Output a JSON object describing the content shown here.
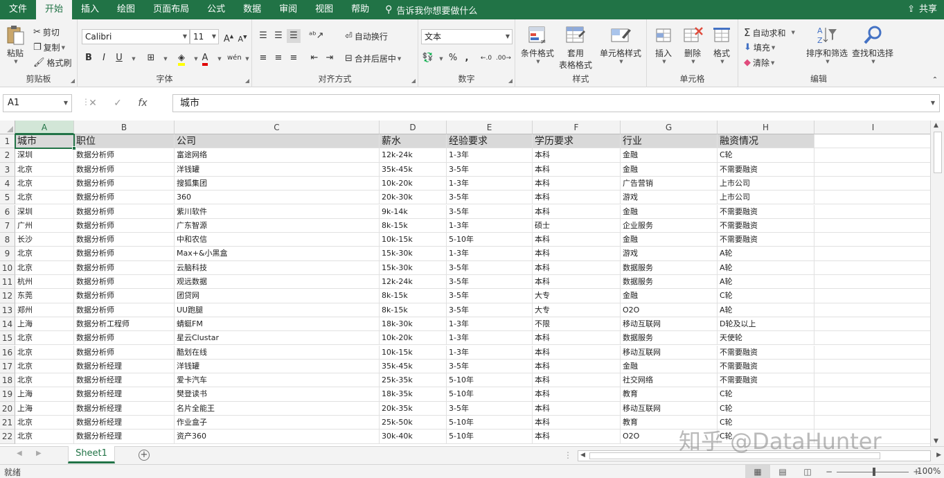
{
  "menu": {
    "tabs": [
      "文件",
      "开始",
      "插入",
      "绘图",
      "页面布局",
      "公式",
      "数据",
      "审阅",
      "视图",
      "帮助"
    ],
    "active_tab": "开始",
    "tell_me": "告诉我你想要做什么",
    "share": "共享"
  },
  "ribbon": {
    "clipboard": {
      "label": "剪贴板",
      "paste": "粘贴",
      "cut": "剪切",
      "copy": "复制",
      "format_painter": "格式刷"
    },
    "font": {
      "label": "字体",
      "font_name": "Calibri",
      "font_size": "11",
      "bold": "B",
      "italic": "I",
      "underline": "U"
    },
    "alignment": {
      "label": "对齐方式",
      "wrap_text": "自动换行",
      "merge_center": "合并后居中"
    },
    "number": {
      "label": "数字",
      "format": "文本",
      "percent": "%",
      "comma": ","
    },
    "styles": {
      "label": "样式",
      "conditional": "条件格式",
      "table_format_1": "套用",
      "table_format_2": "表格格式",
      "cell_styles": "单元格样式"
    },
    "cells": {
      "label": "单元格",
      "insert": "插入",
      "delete": "删除",
      "format": "格式"
    },
    "editing": {
      "label": "编辑",
      "autosum": "自动求和",
      "fill": "填充",
      "clear": "清除",
      "sort_filter": "排序和筛选",
      "find_select": "查找和选择"
    }
  },
  "formula_bar": {
    "name_box": "A1",
    "fx": "fx",
    "content": "城市"
  },
  "grid": {
    "columns": [
      "A",
      "B",
      "C",
      "D",
      "E",
      "F",
      "G",
      "H",
      "I"
    ],
    "selected_column": "A",
    "header_row": [
      "城市",
      "职位",
      "公司",
      "薪水",
      "经验要求",
      "学历要求",
      "行业",
      "融资情况"
    ],
    "rows": [
      [
        "深圳",
        "数据分析师",
        "富途网络",
        "12k-24k",
        "1-3年",
        "本科",
        "金融",
        "C轮"
      ],
      [
        "北京",
        "数据分析师",
        "洋钱罐",
        "35k-45k",
        "3-5年",
        "本科",
        "金融",
        "不需要融资"
      ],
      [
        "北京",
        "数据分析师",
        "搜狐集团",
        "10k-20k",
        "1-3年",
        "本科",
        "广告营销",
        "上市公司"
      ],
      [
        "北京",
        "数据分析师",
        "360",
        "20k-30k",
        "3-5年",
        "本科",
        "游戏",
        "上市公司"
      ],
      [
        "深圳",
        "数据分析师",
        "紫川软件",
        "9k-14k",
        "3-5年",
        "本科",
        "金融",
        "不需要融资"
      ],
      [
        "广州",
        "数据分析师",
        "广东智源",
        "8k-15k",
        "1-3年",
        "硕士",
        "企业服务",
        "不需要融资"
      ],
      [
        "长沙",
        "数据分析师",
        "中和农信",
        "10k-15k",
        "5-10年",
        "本科",
        "金融",
        "不需要融资"
      ],
      [
        "北京",
        "数据分析师",
        "Max+&小黑盒",
        "15k-30k",
        "1-3年",
        "本科",
        "游戏",
        "A轮"
      ],
      [
        "北京",
        "数据分析师",
        "云脑科技",
        "15k-30k",
        "3-5年",
        "本科",
        "数据服务",
        "A轮"
      ],
      [
        "杭州",
        "数据分析师",
        "观远数据",
        "12k-24k",
        "3-5年",
        "本科",
        "数据服务",
        "A轮"
      ],
      [
        "东莞",
        "数据分析师",
        "团贷网",
        "8k-15k",
        "3-5年",
        "大专",
        "金融",
        "C轮"
      ],
      [
        "郑州",
        "数据分析师",
        "UU跑腿",
        "8k-15k",
        "3-5年",
        "大专",
        "O2O",
        "A轮"
      ],
      [
        "上海",
        "数据分析工程师",
        "蜻蜓FM",
        "18k-30k",
        "1-3年",
        "不限",
        "移动互联网",
        "D轮及以上"
      ],
      [
        "北京",
        "数据分析师",
        "星云Clustar",
        "10k-20k",
        "1-3年",
        "本科",
        "数据服务",
        "天使轮"
      ],
      [
        "北京",
        "数据分析师",
        "酷划在线",
        "10k-15k",
        "1-3年",
        "本科",
        "移动互联网",
        "不需要融资"
      ],
      [
        "北京",
        "数据分析经理",
        "洋钱罐",
        "35k-45k",
        "3-5年",
        "本科",
        "金融",
        "不需要融资"
      ],
      [
        "北京",
        "数据分析经理",
        "爱卡汽车",
        "25k-35k",
        "5-10年",
        "本科",
        "社交网络",
        "不需要融资"
      ],
      [
        "上海",
        "数据分析经理",
        "樊登读书",
        "18k-35k",
        "5-10年",
        "本科",
        "教育",
        "C轮"
      ],
      [
        "上海",
        "数据分析经理",
        "名片全能王",
        "20k-35k",
        "3-5年",
        "本科",
        "移动互联网",
        "C轮"
      ],
      [
        "北京",
        "数据分析经理",
        "作业盒子",
        "25k-50k",
        "5-10年",
        "本科",
        "教育",
        "C轮"
      ],
      [
        "北京",
        "数据分析经理",
        "资产360",
        "30k-40k",
        "5-10年",
        "本科",
        "O2O",
        "C轮"
      ]
    ]
  },
  "sheets": {
    "active": "Sheet1",
    "add": "+"
  },
  "status": {
    "text": "就绪",
    "zoom": "100%",
    "zoom_fraction": 1.0
  },
  "watermark": "知乎 @DataHunter",
  "colors": {
    "brand": "#217346",
    "ribbon_bg": "#f3f3f3",
    "header_fill": "#d9d9d9"
  }
}
